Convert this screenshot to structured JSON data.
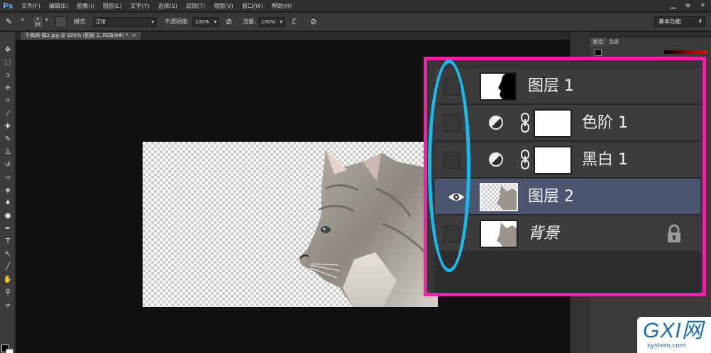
{
  "app": {
    "logo": "Ps"
  },
  "menu": [
    "文件(F)",
    "编辑(E)",
    "图像(I)",
    "图层(L)",
    "文字(Y)",
    "选择(S)",
    "滤镜(T)",
    "视图(V)",
    "窗口(W)",
    "帮助(H)"
  ],
  "window_controls": [
    "▁",
    "⧉",
    "✕"
  ],
  "options": {
    "brush_size": "28",
    "mode_label": "模式:",
    "mode_value": "正常",
    "opacity_label": "不透明度:",
    "opacity_value": "100%",
    "flow_label": "流量:",
    "flow_value": "100%",
    "workspace": "基本功能"
  },
  "document": {
    "tab_title": "千库网-猫2.jpg @ 100% (图层 2, RGB/8#) *",
    "close": "×"
  },
  "color_panel": {
    "tabs": [
      "颜色",
      "色板"
    ]
  },
  "layers": [
    {
      "name": "图层 1",
      "visible": false,
      "type": "mask",
      "selected": false
    },
    {
      "name": "色阶 1",
      "visible": false,
      "type": "adjustment",
      "selected": false
    },
    {
      "name": "黑白 1",
      "visible": false,
      "type": "adjustment",
      "selected": false
    },
    {
      "name": "图层 2",
      "visible": true,
      "type": "image",
      "selected": true
    },
    {
      "name": "背景",
      "visible": false,
      "type": "background",
      "selected": false,
      "locked": true
    }
  ],
  "colors": {
    "callout_border": "#ee24a8",
    "ellipse": "#1ab9ec",
    "selected_layer": "#4d5670"
  },
  "watermark": {
    "logo": "GXI网",
    "sub": "system.com"
  }
}
